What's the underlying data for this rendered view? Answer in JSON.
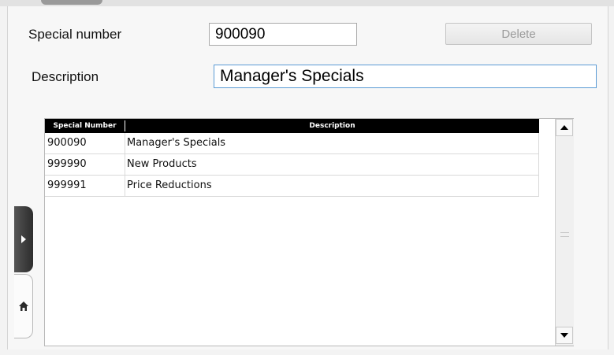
{
  "form": {
    "special_number_label": "Special number",
    "special_number_value": "900090",
    "delete_label": "Delete",
    "description_label": "Description",
    "description_value": "Manager's Specials"
  },
  "table": {
    "columns": [
      "Special Number",
      "Description"
    ],
    "rows": [
      {
        "number": "900090",
        "description": "Manager's Specials"
      },
      {
        "number": "999990",
        "description": "New Products"
      },
      {
        "number": "999991",
        "description": "Price Reductions"
      }
    ]
  },
  "icons": {
    "scroll_up": "arrow-up-icon",
    "scroll_down": "arrow-down-icon",
    "expand": "play-right-icon",
    "home": "home-icon"
  }
}
